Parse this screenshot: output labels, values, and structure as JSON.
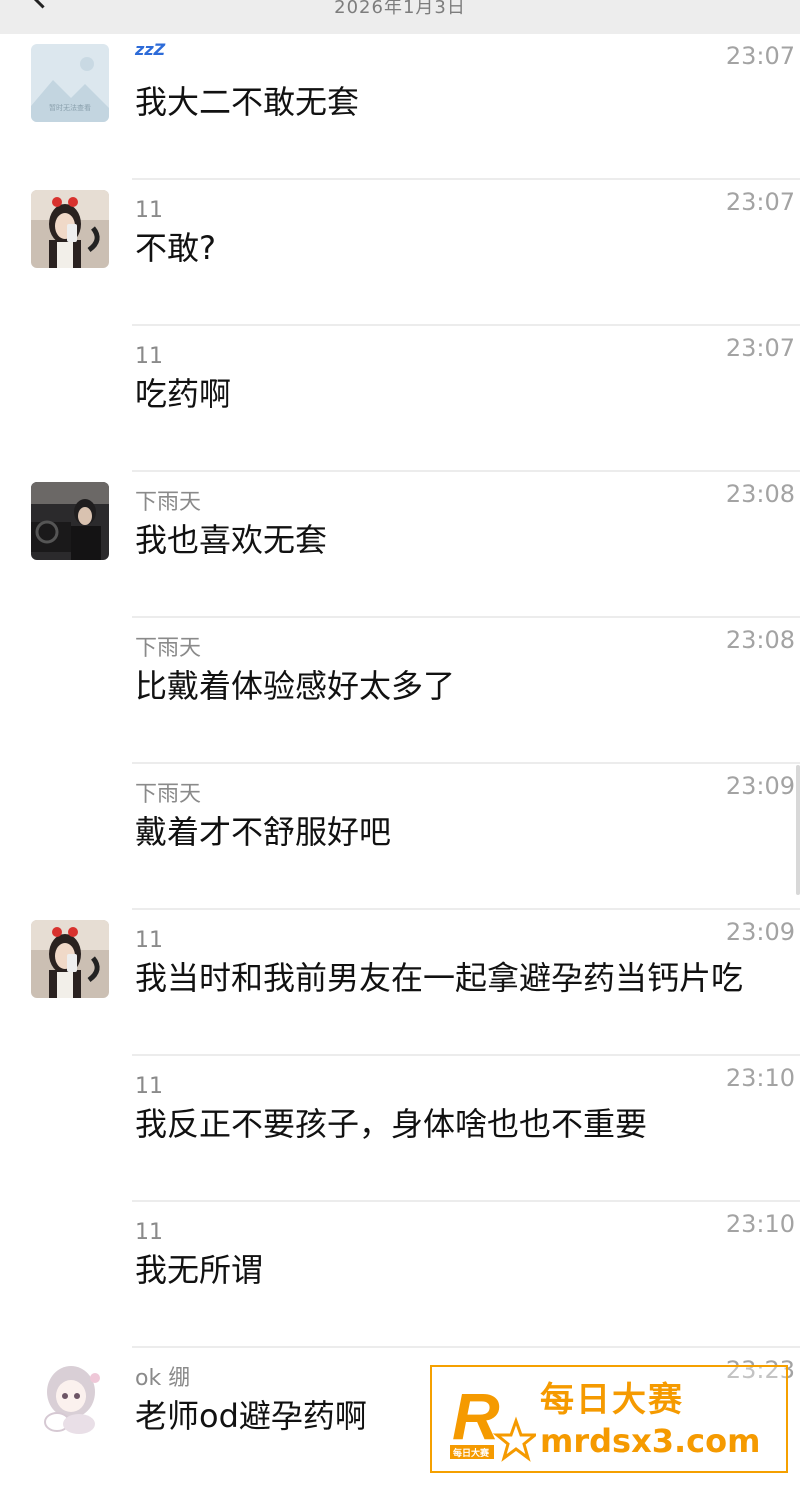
{
  "header": {
    "date": "2026年1月3日"
  },
  "messages": [
    {
      "sender": "",
      "time": "23:07",
      "text": "我大二不敢无套",
      "avatar": "placeholder",
      "has_zzz": true
    },
    {
      "sender": "11",
      "time": "23:07",
      "text": "不敢?",
      "avatar": "girl"
    },
    {
      "sender": "11",
      "time": "23:07",
      "text": "吃药啊",
      "avatar": ""
    },
    {
      "sender": "下雨天",
      "time": "23:08",
      "text": "我也喜欢无套",
      "avatar": "car"
    },
    {
      "sender": "下雨天",
      "time": "23:08",
      "text": "比戴着体验感好太多了",
      "avatar": ""
    },
    {
      "sender": "下雨天",
      "time": "23:09",
      "text": "戴着才不舒服好吧",
      "avatar": ""
    },
    {
      "sender": "11",
      "time": "23:09",
      "text": "我当时和我前男友在一起拿避孕药当钙片吃",
      "avatar": "girl"
    },
    {
      "sender": "11",
      "time": "23:10",
      "text": "我反正不要孩子，身体啥也也不重要",
      "avatar": ""
    },
    {
      "sender": "11",
      "time": "23:10",
      "text": "我无所谓",
      "avatar": ""
    },
    {
      "sender": "ok 绷",
      "time": "23:23",
      "text": "老师od避孕药啊",
      "avatar": "anime"
    }
  ],
  "zzz_label": "zzZ",
  "placeholder_avatar_text": "暂时无法查看",
  "watermark": {
    "line1": "每日大赛",
    "line2": "mrdsx3.com",
    "logo_small": "每日大赛",
    "logo_letter": "R"
  },
  "colors": {
    "accent": "#f59a00",
    "zzz": "#2d6bd8"
  }
}
